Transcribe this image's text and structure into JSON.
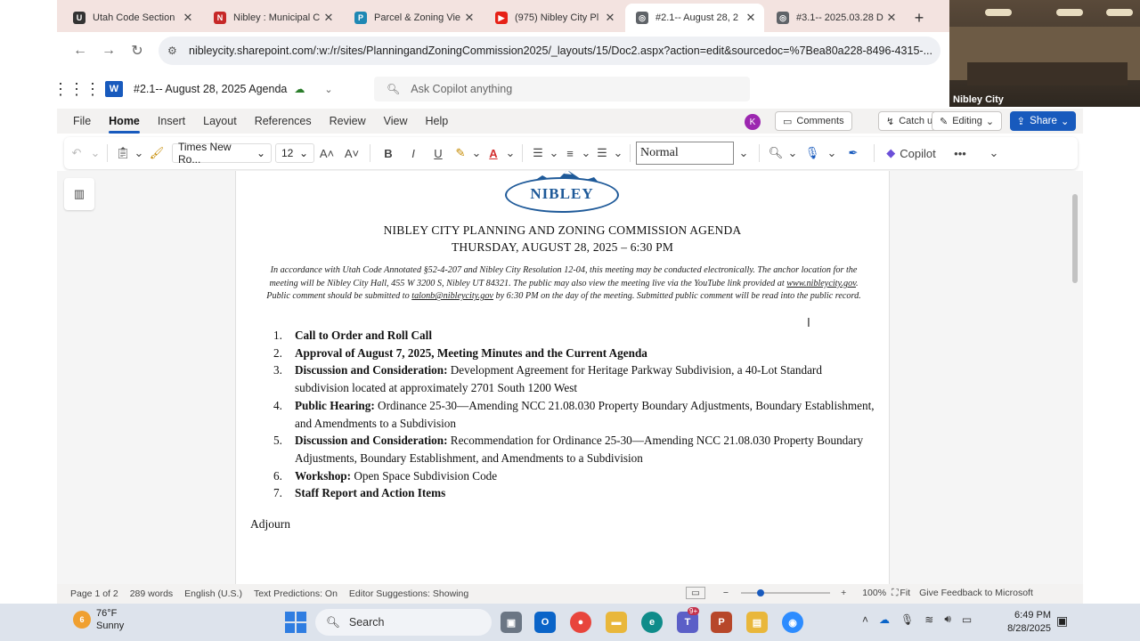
{
  "browser": {
    "tabs": [
      {
        "title": "Utah Code Section",
        "favicon_color": "#333333",
        "favicon_glyph": "U"
      },
      {
        "title": "Nibley : Municipal C",
        "favicon_color": "#c62828",
        "favicon_glyph": "N"
      },
      {
        "title": "Parcel & Zoning Vie",
        "favicon_color": "#1e88b4",
        "favicon_glyph": "P"
      },
      {
        "title": "(975) Nibley City Pl",
        "favicon_color": "#e62117",
        "favicon_glyph": "▶"
      },
      {
        "title": "#2.1-- August 28, 2",
        "favicon_color": "#5f6368",
        "favicon_glyph": "◎",
        "active": true
      },
      {
        "title": "#3.1-- 2025.03.28 D",
        "favicon_color": "#5f6368",
        "favicon_glyph": "◎"
      }
    ],
    "close_glyph": "✕",
    "new_tab_glyph": "+",
    "url": "nibleycity.sharepoint.com/:w:/r/sites/PlanningandZoningCommission2025/_layouts/15/Doc2.aspx?action=edit&sourcedoc=%7Bea80a228-8496-4315-..."
  },
  "video": {
    "label": "Nibley City"
  },
  "word": {
    "doc_title": "#2.1-- August 28, 2025 Agenda",
    "copilot_placeholder": "Ask Copilot anything",
    "menu": [
      "File",
      "Home",
      "Insert",
      "Layout",
      "References",
      "Review",
      "View",
      "Help"
    ],
    "active_menu": "Home",
    "avatar_initial": "K",
    "comments_label": "Comments",
    "catchup_label": "Catch up",
    "editing_label": "Editing",
    "share_label": "Share",
    "font_name": "Times New Ro...",
    "font_size": "12",
    "style_name": "Normal",
    "copilot_label": "Copilot",
    "more_glyph": "•••"
  },
  "document": {
    "logo_text": "NIBLEY",
    "title_line1": "NIBLEY CITY PLANNING AND ZONING COMMISSION AGENDA",
    "title_line2": "THURSDAY, AUGUST 28, 2025 – 6:30 PM",
    "notice_part1": "In accordance with Utah Code Annotated §52-4-207 and Nibley City Resolution 12-04, this meeting may be conducted electronically. The anchor location for the meeting will be Nibley City Hall, 455 W 3200 S, Nibley UT 84321. The public may also view the meeting live via the YouTube link provided at ",
    "notice_link1": "www.nibleycity.gov",
    "notice_part2": ". Public comment should be submitted to ",
    "notice_link2": "talonb@nibleycity.gov",
    "notice_part3": " by 6:30 PM on the day of the meeting. Submitted public comment will be read into the public record.",
    "agenda": [
      {
        "num": "1.",
        "bold": "Call to Order and Roll Call",
        "rest": ""
      },
      {
        "num": "2.",
        "bold": "Approval of August 7, 2025, Meeting Minutes and the Current Agenda",
        "rest": ""
      },
      {
        "num": "3.",
        "bold": "Discussion and Consideration:",
        "rest": " Development Agreement for Heritage Parkway Subdivision, a 40-Lot Standard subdivision located at approximately 2701 South 1200 West"
      },
      {
        "num": "4.",
        "bold": "Public Hearing:",
        "rest": " Ordinance 25-30—Amending NCC 21.08.030 Property Boundary Adjustments, Boundary Establishment, and Amendments to a Subdivision"
      },
      {
        "num": "5.",
        "bold": "Discussion and Consideration:",
        "rest": " Recommendation for Ordinance 25-30—Amending NCC 21.08.030 Property Boundary Adjustments, Boundary Establishment, and Amendments to a Subdivision"
      },
      {
        "num": "6.",
        "bold": "Workshop:",
        "rest": " Open Space Subdivision Code"
      },
      {
        "num": "7.",
        "bold": "Staff Report and Action Items",
        "rest": ""
      }
    ],
    "adjourn": "Adjourn"
  },
  "status": {
    "page": "Page 1 of 2",
    "words": "289 words",
    "language": "English (U.S.)",
    "predictions": "Text Predictions: On",
    "suggestions": "Editor Suggestions: Showing",
    "zoom": "100%",
    "fit": "Fit",
    "feedback": "Give Feedback to Microsoft"
  },
  "taskbar": {
    "weather_temp": "76°F",
    "weather_desc": "Sunny",
    "weather_badge": "6",
    "search_label": "Search",
    "teams_badge": "9+",
    "time": "6:49 PM",
    "date": "8/28/2025"
  }
}
